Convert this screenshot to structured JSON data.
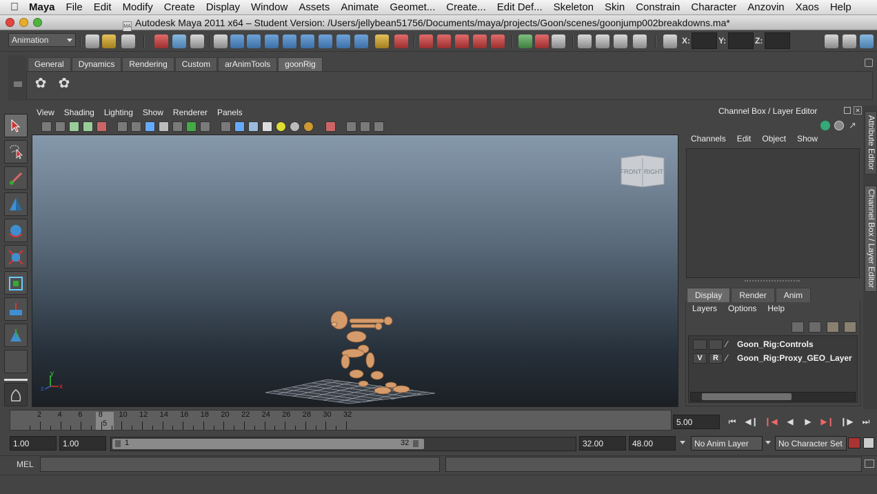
{
  "menubar": {
    "app": "Maya",
    "items": [
      "File",
      "Edit",
      "Modify",
      "Create",
      "Display",
      "Window",
      "Assets",
      "Animate",
      "Geomet...",
      "Create...",
      "Edit Def...",
      "Skeleton",
      "Skin",
      "Constrain",
      "Character",
      "Anzovin",
      "Xaos",
      "Help"
    ]
  },
  "window": {
    "title": "Autodesk Maya 2011 x64 – Student Version: /Users/jellybean51756/Documents/maya/projects/Goon/scenes/goonjump002breakdowns.ma*",
    "doc_icon_text": "MA"
  },
  "statusline": {
    "menuset": "Animation",
    "x_label": "X:",
    "y_label": "Y:",
    "z_label": "Z:"
  },
  "shelf": {
    "tabs": [
      "General",
      "Dynamics",
      "Rendering",
      "Custom",
      "arAnimTools",
      "goonRig"
    ],
    "active_tab": "goonRig"
  },
  "panel": {
    "menu": [
      "View",
      "Shading",
      "Lighting",
      "Show",
      "Renderer",
      "Panels"
    ],
    "viewcube_front": "FRONT",
    "viewcube_right": "RIGHT",
    "axis_x": "x",
    "axis_y": "y",
    "axis_z": "z"
  },
  "channel_box": {
    "title": "Channel Box / Layer Editor",
    "menu": [
      "Channels",
      "Edit",
      "Object",
      "Show"
    ]
  },
  "layer_editor": {
    "tabs": [
      "Display",
      "Render",
      "Anim"
    ],
    "active_tab": "Display",
    "menu": [
      "Layers",
      "Options",
      "Help"
    ],
    "layers": [
      {
        "v": "",
        "r": "",
        "name": "Goon_Rig:Controls"
      },
      {
        "v": "V",
        "r": "R",
        "name": "Goon_Rig:Proxy_GEO_Layer"
      }
    ]
  },
  "side_tabs": [
    "Attribute Editor",
    "Channel Box / Layer Editor"
  ],
  "timeslider": {
    "labels": [
      "2",
      "4",
      "6",
      "8",
      "10",
      "12",
      "14",
      "16",
      "18",
      "20",
      "22",
      "24",
      "26",
      "28",
      "30",
      "32"
    ],
    "current_frame": "5",
    "current_time": "5.00"
  },
  "range": {
    "start": "1.00",
    "playback_start": "1.00",
    "slider_start": "1",
    "slider_end": "32",
    "playback_end": "32.00",
    "end": "48.00",
    "anim_layer": "No Anim Layer",
    "character_set": "No Character Set"
  },
  "commandline": {
    "label": "MEL"
  },
  "colors": {
    "bg": "#444444",
    "viewport_top": "#8699ac",
    "viewport_bottom": "#1b1f24",
    "character": "#d59b6a"
  }
}
